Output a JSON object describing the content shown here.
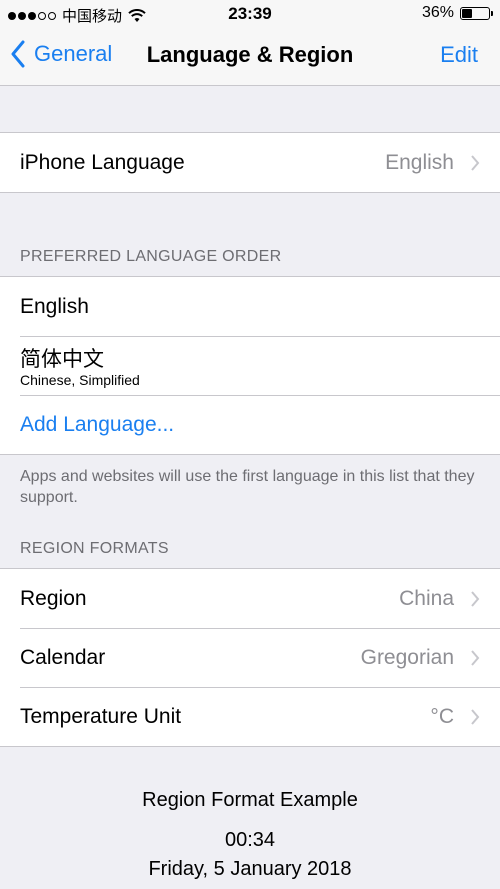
{
  "status_bar": {
    "carrier": "中国移动",
    "time": "23:39",
    "battery_percent": "36%",
    "battery_level": 0.36,
    "signal_filled": 3,
    "signal_total": 5
  },
  "nav": {
    "back_label": "General",
    "title": "Language & Region",
    "edit_label": "Edit"
  },
  "iphone_language": {
    "label": "iPhone Language",
    "value": "English"
  },
  "preferred": {
    "header": "PREFERRED LANGUAGE ORDER",
    "items": [
      {
        "label": "English"
      },
      {
        "label": "简体中文",
        "sub": "Chinese, Simplified"
      }
    ],
    "add_label": "Add Language...",
    "footer": "Apps and websites will use the first language in this list that they support."
  },
  "region_formats": {
    "header": "REGION FORMATS",
    "rows": [
      {
        "label": "Region",
        "value": "China"
      },
      {
        "label": "Calendar",
        "value": "Gregorian"
      },
      {
        "label": "Temperature Unit",
        "value": "°C"
      }
    ]
  },
  "example": {
    "title": "Region Format Example",
    "time": "00:34",
    "date": "Friday, 5 January 2018"
  },
  "colors": {
    "accent": "#1a7ff0",
    "background": "#efeff4",
    "secondary_text": "#8e8e93"
  }
}
